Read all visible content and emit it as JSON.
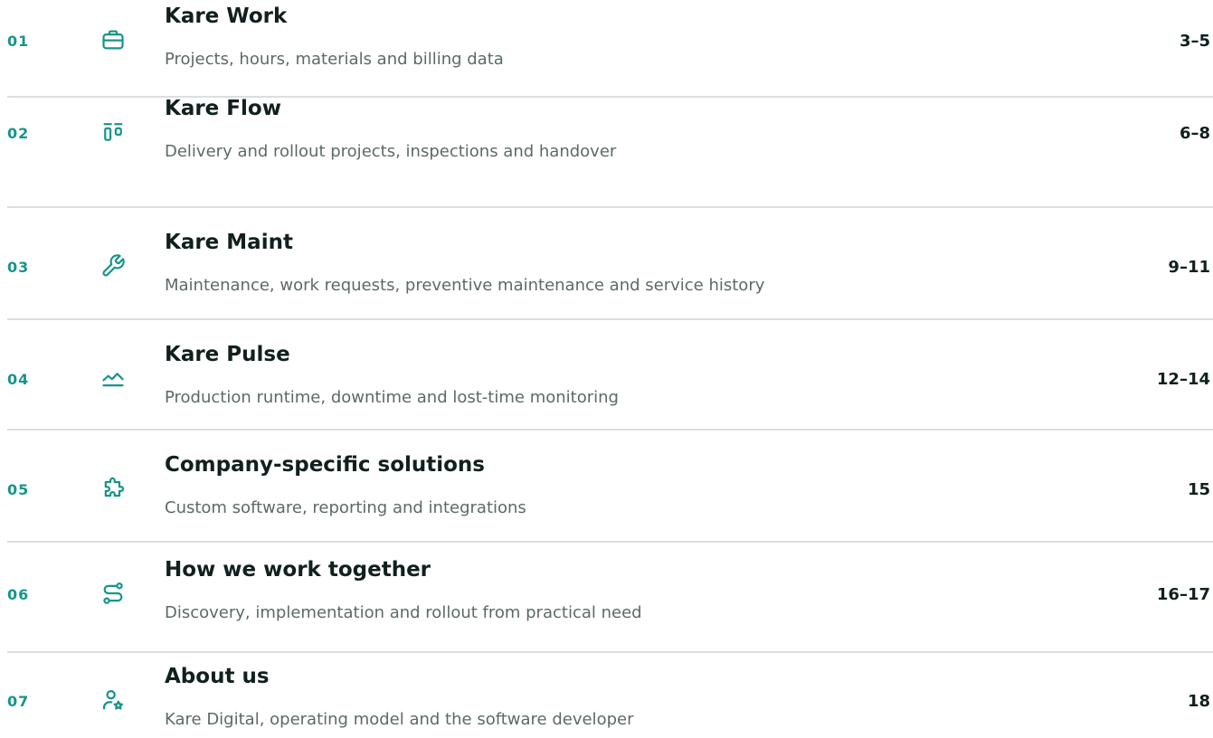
{
  "toc": {
    "accent_color": "#17958a",
    "items": [
      {
        "number": "01",
        "icon": "briefcase-icon",
        "title": "Kare Work",
        "description": "Projects, hours, materials and billing data",
        "pages": "3–5"
      },
      {
        "number": "02",
        "icon": "kanban-icon",
        "title": "Kare Flow",
        "description": "Delivery and rollout projects, inspections and handover",
        "pages": "6–8"
      },
      {
        "number": "03",
        "icon": "wrench-icon",
        "title": "Kare Maint",
        "description": "Maintenance, work requests, preventive maintenance and service history",
        "pages": "9–11"
      },
      {
        "number": "04",
        "icon": "trend-line-icon",
        "title": "Kare Pulse",
        "description": "Production runtime, downtime and lost-time monitoring",
        "pages": "12–14"
      },
      {
        "number": "05",
        "icon": "puzzle-icon",
        "title": "Company-specific solutions",
        "description": "Custom software, reporting and integrations",
        "pages": "15"
      },
      {
        "number": "06",
        "icon": "route-icon",
        "title": "How we work together",
        "description": "Discovery, implementation and rollout from practical need",
        "pages": "16–17"
      },
      {
        "number": "07",
        "icon": "user-star-icon",
        "title": "About us",
        "description": "Kare Digital, operating model and the software developer",
        "pages": "18"
      }
    ]
  }
}
